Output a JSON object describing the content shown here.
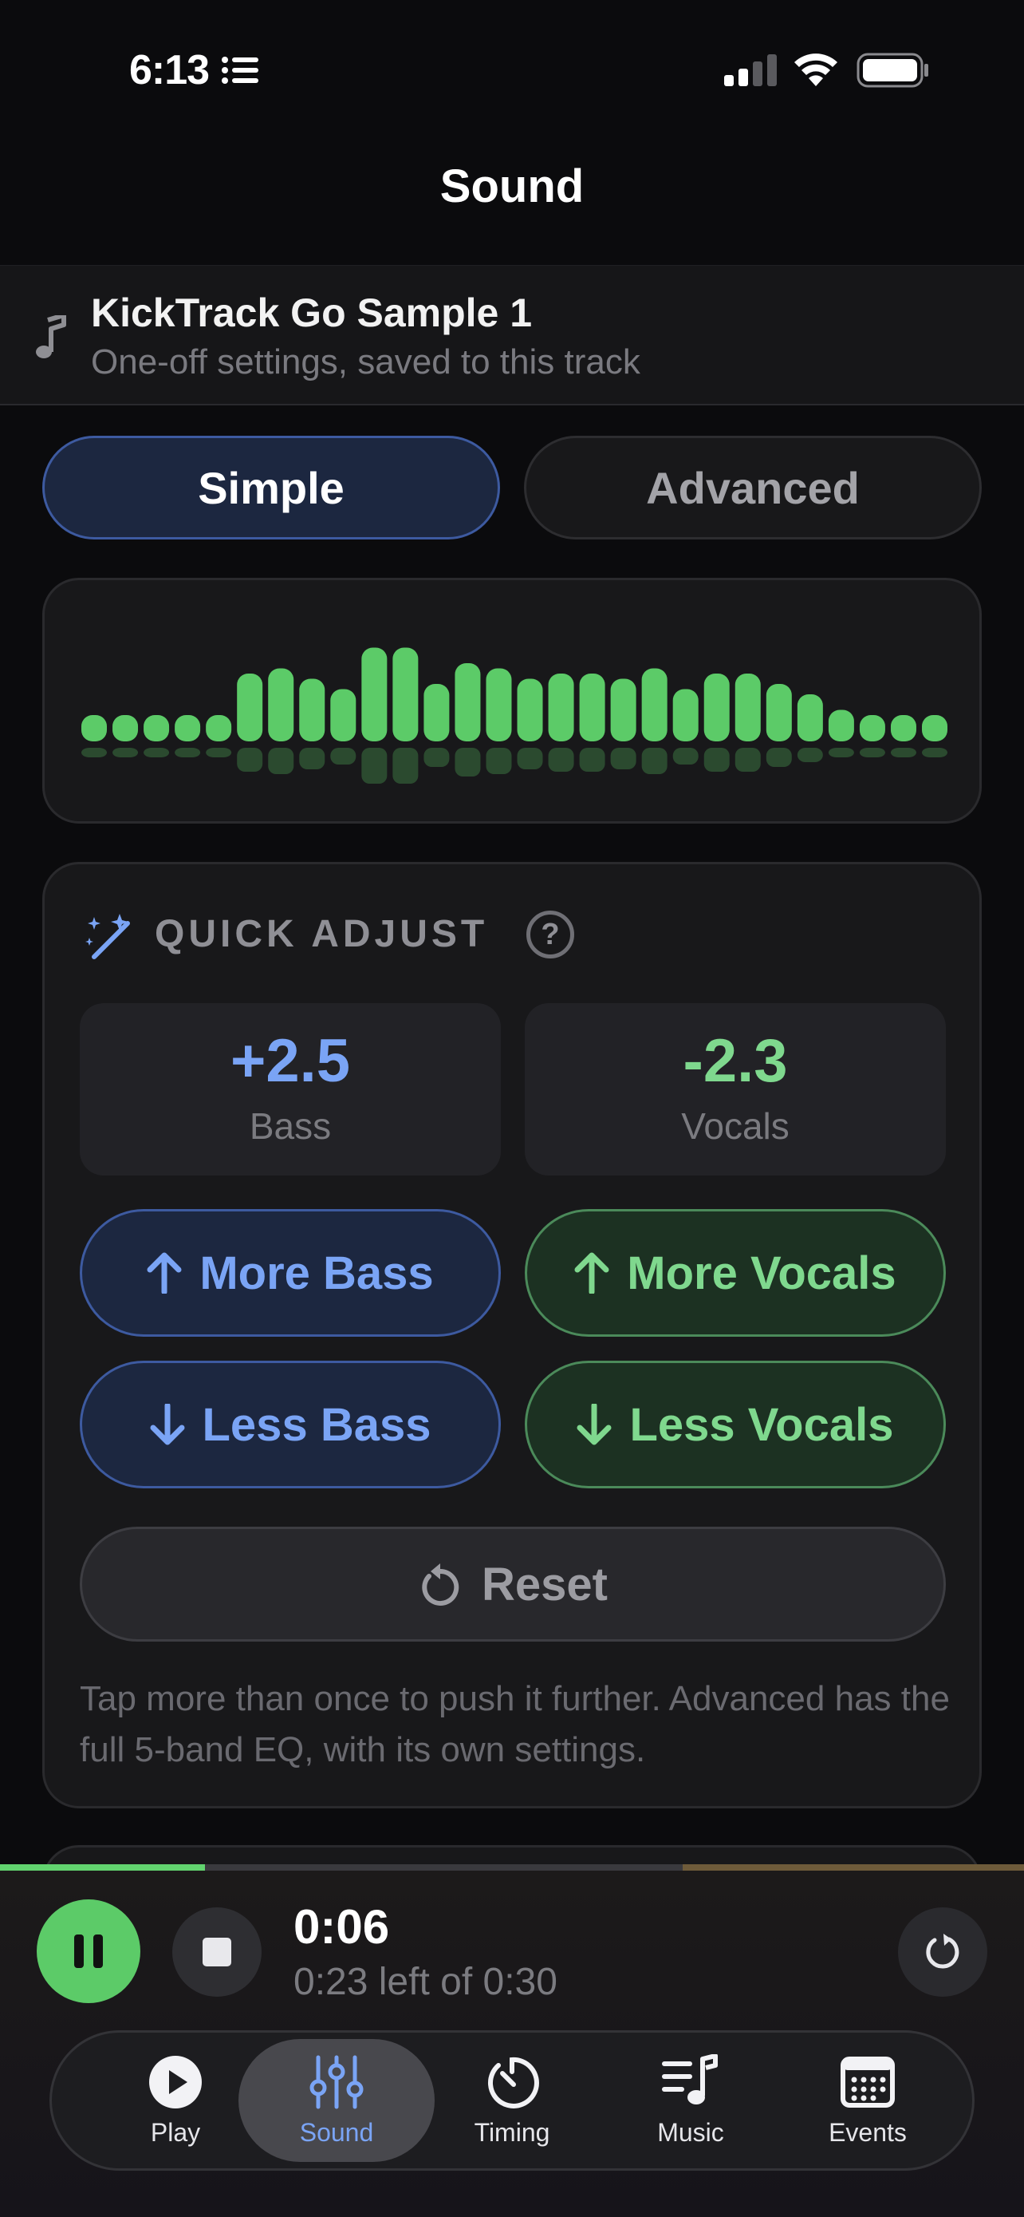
{
  "status_bar": {
    "time": "6:13"
  },
  "page": {
    "title": "Sound"
  },
  "track": {
    "title": "KickTrack Go Sample 1",
    "subtitle": "One-off settings, saved to this track"
  },
  "mode_tabs": {
    "simple": "Simple",
    "advanced": "Advanced",
    "selected": "Simple"
  },
  "visualizer": {
    "levels": [
      0.1,
      0.1,
      0.1,
      0.1,
      0.1,
      0.5,
      0.55,
      0.45,
      0.35,
      0.75,
      0.75,
      0.4,
      0.6,
      0.55,
      0.45,
      0.5,
      0.5,
      0.45,
      0.55,
      0.35,
      0.5,
      0.5,
      0.4,
      0.3,
      0.15,
      0.1,
      0.1,
      0.1
    ],
    "color": "#5ccb68"
  },
  "quick_adjust": {
    "title": "QUICK ADJUST",
    "bass": {
      "value": "+2.5",
      "label": "Bass"
    },
    "vocals": {
      "value": "-2.3",
      "label": "Vocals"
    },
    "more_bass": "More Bass",
    "more_vocals": "More Vocals",
    "less_bass": "Less Bass",
    "less_vocals": "Less Vocals",
    "reset": "Reset",
    "hint": "Tap more than once to push it further. Advanced has the full 5-band EQ, with its own settings."
  },
  "player": {
    "elapsed": "0:06",
    "remaining": "0:23 left of 0:30",
    "progress": 0.2
  },
  "tabs": [
    {
      "label": "Play",
      "icon": "play-icon"
    },
    {
      "label": "Sound",
      "icon": "sliders-icon",
      "selected": true
    },
    {
      "label": "Timing",
      "icon": "timer-icon"
    },
    {
      "label": "Music",
      "icon": "music-list-icon"
    },
    {
      "label": "Events",
      "icon": "calendar-icon"
    }
  ],
  "colors": {
    "accent_blue": "#7aa4f5",
    "accent_green": "#7fd88e",
    "play_green": "#5ccb68"
  }
}
